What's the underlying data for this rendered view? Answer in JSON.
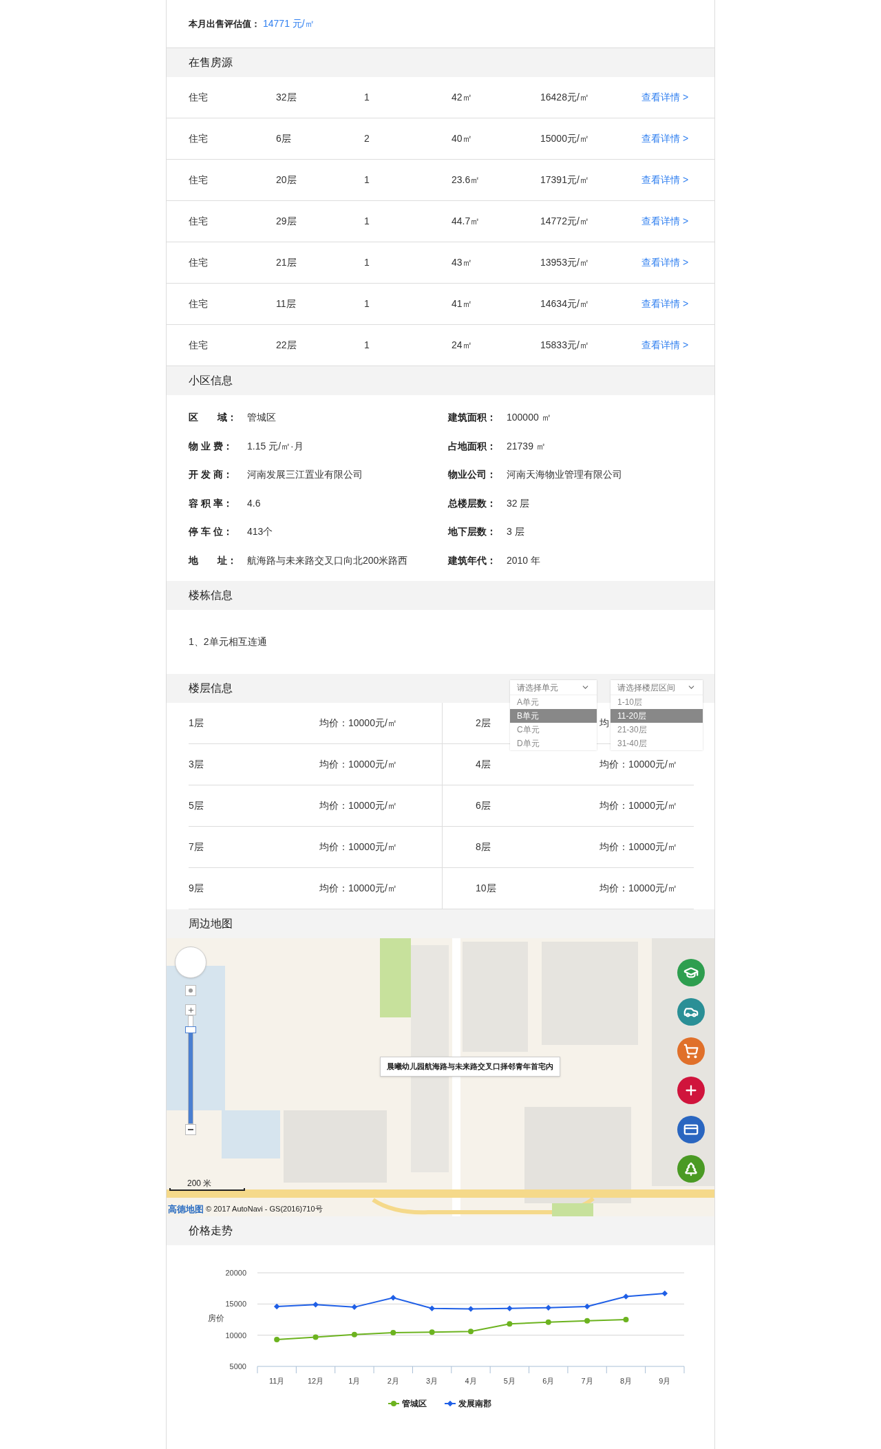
{
  "summary": {
    "label": "本月出售评估值：",
    "value": "14771 元/㎡"
  },
  "listings": {
    "title": "在售房源",
    "rows": [
      {
        "type": "住宅",
        "floor": "32层",
        "rooms": "1",
        "area": "42㎡",
        "price": "16428元/㎡",
        "link": "查看详情 >"
      },
      {
        "type": "住宅",
        "floor": "6层",
        "rooms": "2",
        "area": "40㎡",
        "price": "15000元/㎡",
        "link": "查看详情 >"
      },
      {
        "type": "住宅",
        "floor": "20层",
        "rooms": "1",
        "area": "23.6㎡",
        "price": "17391元/㎡",
        "link": "查看详情 >"
      },
      {
        "type": "住宅",
        "floor": "29层",
        "rooms": "1",
        "area": "44.7㎡",
        "price": "14772元/㎡",
        "link": "查看详情 >"
      },
      {
        "type": "住宅",
        "floor": "21层",
        "rooms": "1",
        "area": "43㎡",
        "price": "13953元/㎡",
        "link": "查看详情 >"
      },
      {
        "type": "住宅",
        "floor": "11层",
        "rooms": "1",
        "area": "41㎡",
        "price": "14634元/㎡",
        "link": "查看详情 >"
      },
      {
        "type": "住宅",
        "floor": "22层",
        "rooms": "1",
        "area": "24㎡",
        "price": "15833元/㎡",
        "link": "查看详情 >"
      }
    ]
  },
  "community": {
    "title": "小区信息",
    "rows": [
      [
        {
          "label": "区　　域：",
          "value": "管城区"
        },
        {
          "label": "建筑面积：",
          "value": "100000 ㎡"
        }
      ],
      [
        {
          "label": "物 业 费：",
          "value": "1.15 元/㎡·月"
        },
        {
          "label": "占地面积：",
          "value": "21739 ㎡"
        }
      ],
      [
        {
          "label": "开 发 商：",
          "value": "河南发展三江置业有限公司"
        },
        {
          "label": "物业公司：",
          "value": "河南天海物业管理有限公司"
        }
      ],
      [
        {
          "label": "容 积 率：",
          "value": "4.6"
        },
        {
          "label": "总楼层数：",
          "value": "32 层"
        }
      ],
      [
        {
          "label": "停 车 位：",
          "value": "413个"
        },
        {
          "label": "地下层数：",
          "value": "3 层"
        }
      ],
      [
        {
          "label": "地　　址：",
          "value": "航海路与未来路交叉口向北200米路西"
        },
        {
          "label": "建筑年代：",
          "value": "2010 年"
        }
      ]
    ]
  },
  "building": {
    "title": "楼栋信息",
    "text": "1、2单元相互连通"
  },
  "floors": {
    "title": "楼层信息",
    "unit_select": {
      "placeholder": "请选择单元",
      "options": [
        {
          "label": "A单元",
          "selected": false
        },
        {
          "label": "B单元",
          "selected": true
        },
        {
          "label": "C单元",
          "selected": false
        },
        {
          "label": "D单元",
          "selected": false
        }
      ]
    },
    "range_select": {
      "placeholder": "请选择楼层区间",
      "options": [
        {
          "label": "1-10层",
          "selected": false
        },
        {
          "label": "11-20层",
          "selected": true
        },
        {
          "label": "21-30层",
          "selected": false
        },
        {
          "label": "31-40层",
          "selected": false
        }
      ]
    },
    "rows": [
      [
        {
          "floor": "1层",
          "price": "均价：10000元/㎡"
        },
        {
          "floor": "2层",
          "price": "均"
        }
      ],
      [
        {
          "floor": "3层",
          "price": "均价：10000元/㎡"
        },
        {
          "floor": "4层",
          "price": "均价：10000元/㎡"
        }
      ],
      [
        {
          "floor": "5层",
          "price": "均价：10000元/㎡"
        },
        {
          "floor": "6层",
          "price": "均价：10000元/㎡"
        }
      ],
      [
        {
          "floor": "7层",
          "price": "均价：10000元/㎡"
        },
        {
          "floor": "8层",
          "price": "均价：10000元/㎡"
        }
      ],
      [
        {
          "floor": "9层",
          "price": "均价：10000元/㎡"
        },
        {
          "floor": "10层",
          "price": "均价：10000元/㎡"
        }
      ]
    ]
  },
  "map": {
    "title": "周边地图",
    "zoom": {
      "level": 0.87
    },
    "popup": "晨曦幼儿园航海路与未来路交叉口择邻青年首宅内",
    "scale": "200 米",
    "logo": "高德地图",
    "copyright": "© 2017 AutoNavi - GS(2016)710号",
    "poi_buttons": [
      {
        "kind": "school",
        "color": "#2e9e4f"
      },
      {
        "kind": "car",
        "color": "#2a8f96"
      },
      {
        "kind": "shopping",
        "color": "#e0702a"
      },
      {
        "kind": "hospital",
        "color": "#d0143c"
      },
      {
        "kind": "bank",
        "color": "#2a66c0"
      },
      {
        "kind": "park",
        "color": "#4a9a24"
      }
    ]
  },
  "trend": {
    "title": "价格走势",
    "chart_data": {
      "type": "line",
      "ylabel": "房价",
      "categories": [
        "11月",
        "12月",
        "1月",
        "2月",
        "3月",
        "4月",
        "5月",
        "6月",
        "7月",
        "8月",
        "9月"
      ],
      "series": [
        {
          "name": "管城区",
          "color": "#6cb31f",
          "marker": "circle",
          "values": [
            9300,
            9700,
            10100,
            10400,
            10500,
            10600,
            11800,
            12100,
            12300,
            12500,
            null
          ]
        },
        {
          "name": "发展南郡",
          "color": "#1f5fe6",
          "marker": "diamond",
          "values": [
            14600,
            14900,
            14500,
            16000,
            14300,
            14200,
            14300,
            14400,
            14600,
            16200,
            16700
          ]
        }
      ],
      "legend": true,
      "ylim": [
        5000,
        20000
      ],
      "yticks": [
        5000,
        10000,
        15000,
        20000
      ]
    }
  }
}
